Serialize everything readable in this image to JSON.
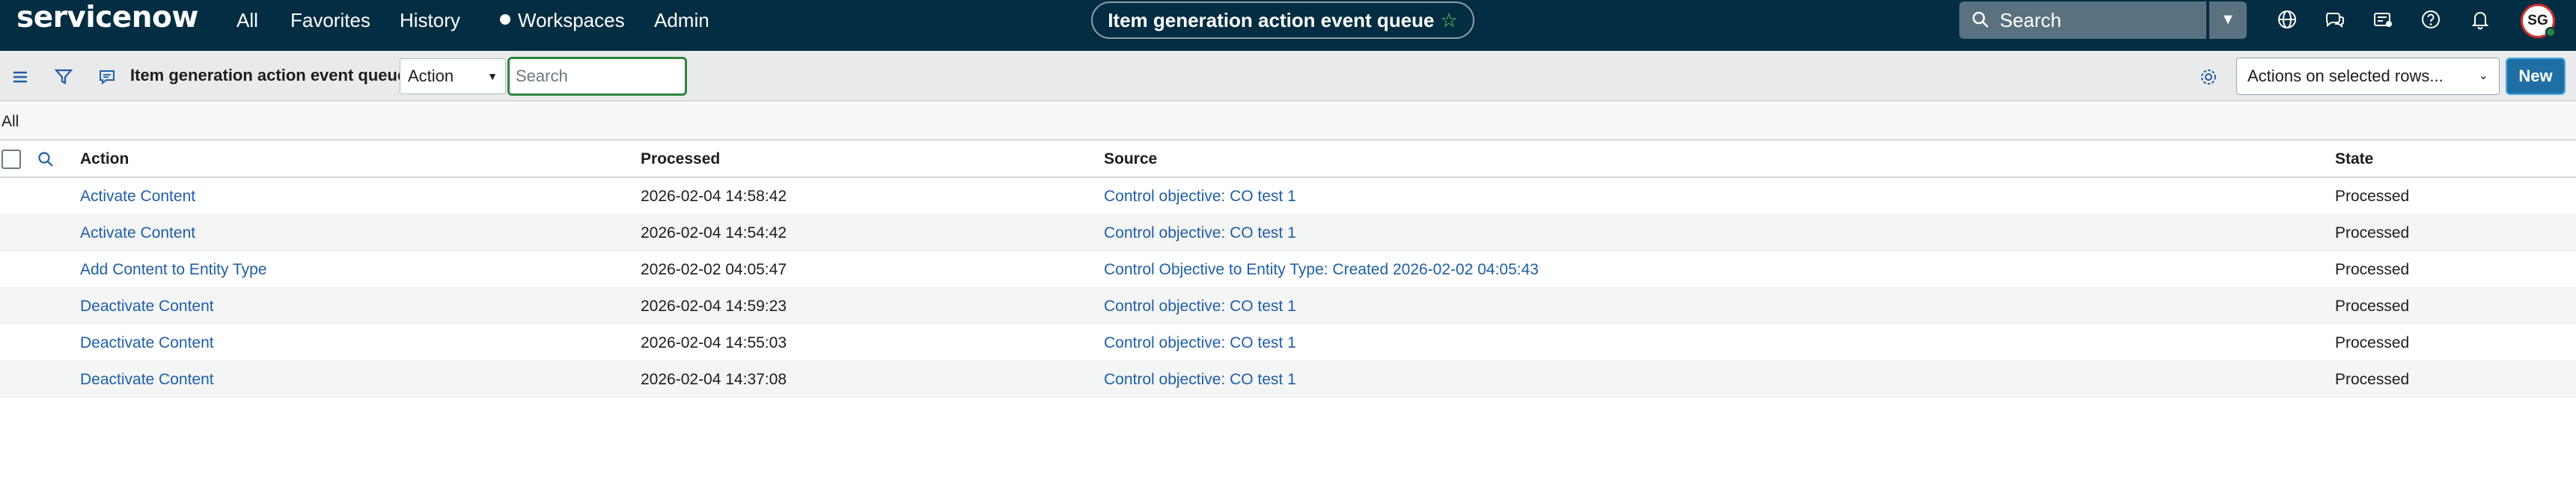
{
  "header": {
    "logo_text": "servicenow",
    "nav": {
      "all": "All",
      "favorites": "Favorites",
      "history": "History",
      "workspaces": "Workspaces",
      "admin": "Admin"
    },
    "title": "Item generation action event queue",
    "search_placeholder": "Search",
    "avatar_initials": "SG",
    "icons": [
      "search-icon",
      "chevron-down-icon",
      "globe-icon",
      "chat-icon",
      "inbox-icon",
      "help-icon",
      "bell-icon"
    ],
    "colors": {
      "bar": "#032d42",
      "accent_green": "#62d84e"
    }
  },
  "toolbar": {
    "list_title": "Item generation action event queue",
    "field_select": "Action",
    "search_placeholder": "Search",
    "rows_action": "Actions on selected rows...",
    "new_label": "New",
    "colors": {
      "new_button": "#1f6fa5",
      "search_focus": "#2e8540"
    }
  },
  "breadcrumb": "All",
  "table": {
    "columns": [
      "Action",
      "Processed",
      "Source",
      "State"
    ],
    "rows": [
      {
        "action": "Activate Content",
        "processed": "2026-02-04 14:58:42",
        "source": "Control objective: CO test 1",
        "state": "Processed"
      },
      {
        "action": "Activate Content",
        "processed": "2026-02-04 14:54:42",
        "source": "Control objective: CO test 1",
        "state": "Processed"
      },
      {
        "action": "Add Content to Entity Type",
        "processed": "2026-02-02 04:05:47",
        "source": "Control Objective to Entity Type: Created 2026-02-02 04:05:43",
        "state": "Processed"
      },
      {
        "action": "Deactivate Content",
        "processed": "2026-02-04 14:59:23",
        "source": "Control objective: CO test 1",
        "state": "Processed"
      },
      {
        "action": "Deactivate Content",
        "processed": "2026-02-04 14:55:03",
        "source": "Control objective: CO test 1",
        "state": "Processed"
      },
      {
        "action": "Deactivate Content",
        "processed": "2026-02-04 14:37:08",
        "source": "Control objective: CO test 1",
        "state": "Processed"
      }
    ],
    "colors": {
      "link": "#1f5fa6",
      "alt_row": "#f4f5f5"
    }
  }
}
